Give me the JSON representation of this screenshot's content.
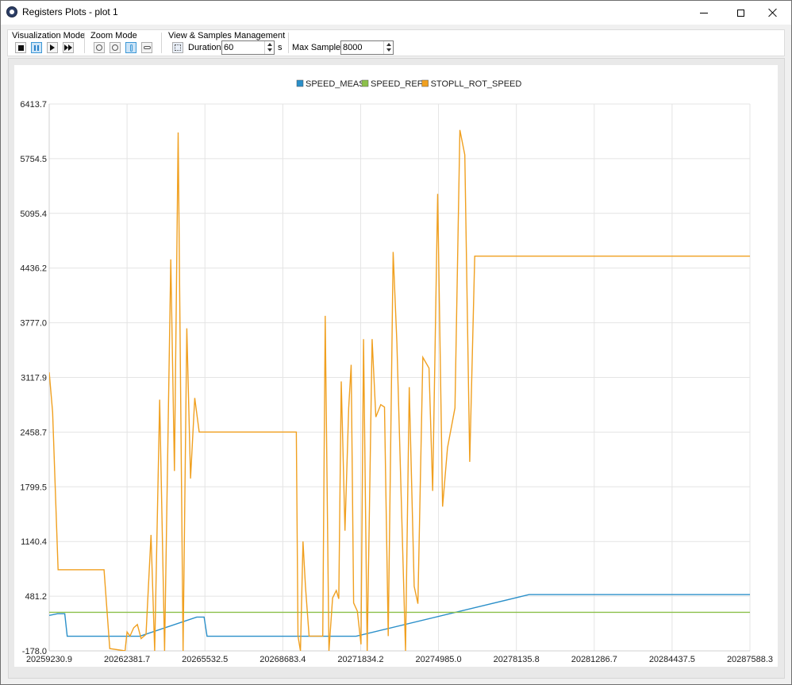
{
  "window": {
    "title": "Registers Plots - plot 1"
  },
  "toolbar": {
    "visualization_mode_label": "Visualization Mode",
    "zoom_mode_label": "Zoom Mode",
    "view_samples_label": "View & Samples Management",
    "duration_label": "Duration",
    "duration_value": "60",
    "duration_unit": "s",
    "max_samples_label": "Max Samples",
    "max_samples_value": "8000",
    "visualization_buttons": [
      "stop-icon",
      "pause-icon",
      "play-icon",
      "fast-forward-icon"
    ],
    "visualization_active": "pause-icon",
    "zoom_buttons": [
      "zoom-xy-icon",
      "zoom-center-icon",
      "zoom-vertical-icon",
      "zoom-horizontal-icon"
    ],
    "zoom_active": "zoom-vertical-icon"
  },
  "chart_data": {
    "type": "line",
    "title": "",
    "xlabel": "",
    "ylabel": "",
    "xlim": [
      20259230.9,
      20287588.3
    ],
    "ylim": [
      -178.0,
      6413.7
    ],
    "grid": true,
    "legend_position": "top-center",
    "x_ticks": [
      "20259230.9",
      "20262381.7",
      "20265532.5",
      "20268683.4",
      "20271834.2",
      "20274985.0",
      "20278135.8",
      "20281286.7",
      "20284437.5",
      "20287588.3"
    ],
    "y_ticks": [
      "-178.0",
      "481.2",
      "1140.4",
      "1799.5",
      "2458.7",
      "3117.9",
      "3777.0",
      "4436.2",
      "5095.4",
      "5754.5",
      "6413.7"
    ],
    "series": [
      {
        "name": "SPEED_MEAS",
        "color": "#2a8fc9",
        "points": [
          [
            20259230.9,
            250
          ],
          [
            20259570,
            270
          ],
          [
            20259860,
            270
          ],
          [
            20259960,
            -2
          ],
          [
            20262900,
            -2
          ],
          [
            20265200,
            230
          ],
          [
            20265500,
            230
          ],
          [
            20265620,
            -2
          ],
          [
            20270200,
            -2
          ],
          [
            20271650,
            -2
          ],
          [
            20278650,
            500
          ],
          [
            20287588.3,
            500
          ]
        ]
      },
      {
        "name": "SPEED_REF",
        "color": "#8cc04a",
        "points": [
          [
            20259230.9,
            287
          ],
          [
            20287588.3,
            287
          ]
        ]
      },
      {
        "name": "STOPLL_ROT_SPEED",
        "color": "#f0a020",
        "points": [
          [
            20259230.9,
            3180
          ],
          [
            20259370,
            2700
          ],
          [
            20259590,
            800
          ],
          [
            20261450,
            800
          ],
          [
            20261680,
            -150
          ],
          [
            20262300,
            -178
          ],
          [
            20262380,
            50
          ],
          [
            20262500,
            0
          ],
          [
            20262650,
            100
          ],
          [
            20262800,
            140
          ],
          [
            20262950,
            -30
          ],
          [
            20263150,
            20
          ],
          [
            20263350,
            1220
          ],
          [
            20263500,
            -178
          ],
          [
            20263700,
            2850
          ],
          [
            20263900,
            -178
          ],
          [
            20264150,
            4540
          ],
          [
            20264300,
            1990
          ],
          [
            20264450,
            6070
          ],
          [
            20264650,
            -178
          ],
          [
            20264800,
            3710
          ],
          [
            20264950,
            1900
          ],
          [
            20265120,
            2870
          ],
          [
            20265300,
            2460
          ],
          [
            20269230,
            2460
          ],
          [
            20269300,
            0
          ],
          [
            20269400,
            -178
          ],
          [
            20269500,
            1140
          ],
          [
            20269600,
            600
          ],
          [
            20269750,
            0
          ],
          [
            20270300,
            0
          ],
          [
            20270400,
            3860
          ],
          [
            20270550,
            -178
          ],
          [
            20270700,
            460
          ],
          [
            20270850,
            550
          ],
          [
            20270950,
            450
          ],
          [
            20271050,
            3070
          ],
          [
            20271200,
            1270
          ],
          [
            20271350,
            2750
          ],
          [
            20271450,
            3270
          ],
          [
            20271550,
            400
          ],
          [
            20271700,
            300
          ],
          [
            20271850,
            -100
          ],
          [
            20271950,
            3580
          ],
          [
            20272100,
            -178
          ],
          [
            20272300,
            3580
          ],
          [
            20272450,
            2640
          ],
          [
            20272650,
            2790
          ],
          [
            20272800,
            2760
          ],
          [
            20272950,
            0
          ],
          [
            20273150,
            4630
          ],
          [
            20273300,
            3540
          ],
          [
            20273650,
            -178
          ],
          [
            20273800,
            3000
          ],
          [
            20274000,
            600
          ],
          [
            20274150,
            390
          ],
          [
            20274350,
            3360
          ],
          [
            20274600,
            3230
          ],
          [
            20274750,
            1750
          ],
          [
            20274950,
            5330
          ],
          [
            20275150,
            1560
          ],
          [
            20275350,
            2270
          ],
          [
            20275650,
            2750
          ],
          [
            20275850,
            6100
          ],
          [
            20276050,
            5800
          ],
          [
            20276250,
            2100
          ],
          [
            20276450,
            4580
          ],
          [
            20287588.3,
            4580
          ]
        ]
      }
    ]
  }
}
